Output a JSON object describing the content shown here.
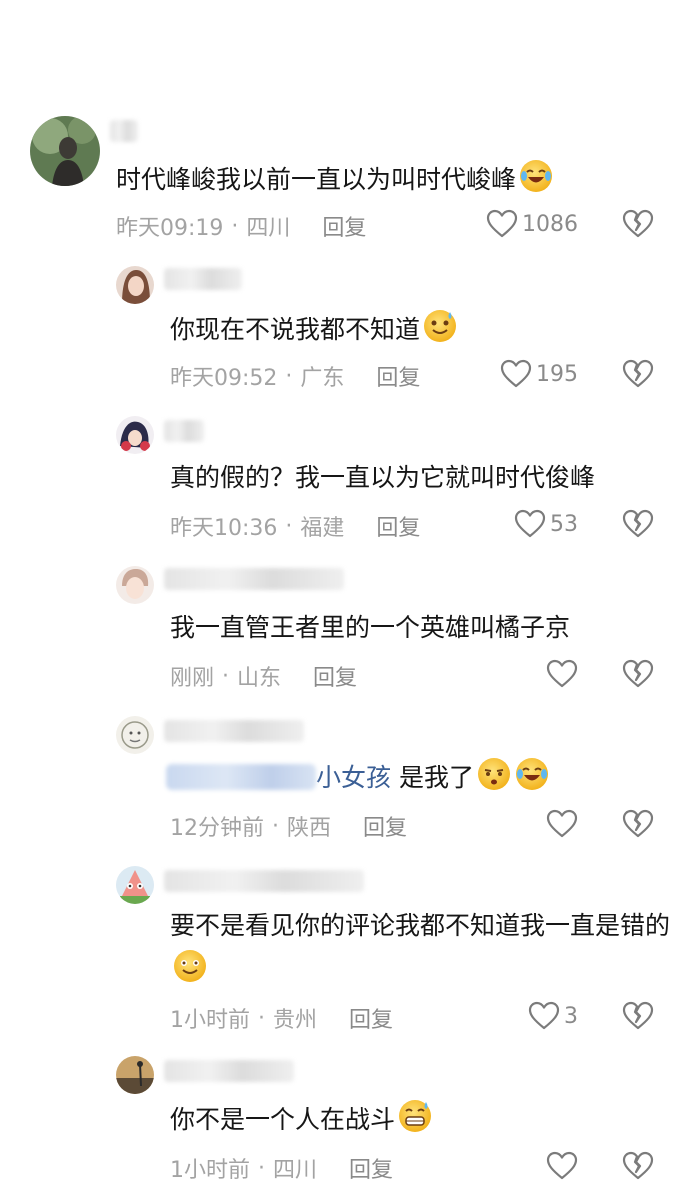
{
  "comments": [
    {
      "text": "时代峰峻我以前一直以为叫时代峻峰",
      "emoji": "laughing-crying-emoji",
      "time": "昨天09:19",
      "location": "四川",
      "reply": "回复",
      "likes": "1086"
    },
    {
      "text": "你现在不说我都不知道",
      "emoji": "sweat-smile-emoji",
      "time": "昨天09:52",
      "location": "广东",
      "reply": "回复",
      "likes": "195"
    },
    {
      "text": "真的假的？我一直以为它就叫时代俊峰",
      "time": "昨天10:36",
      "location": "福建",
      "reply": "回复",
      "likes": "53"
    },
    {
      "text": "我一直管王者里的一个英雄叫橘子京",
      "time": "刚刚",
      "location": "山东",
      "reply": "回复",
      "likes": ""
    },
    {
      "link_text": "小女孩",
      "text": " 是我了",
      "emoji": "smirk-emoji",
      "emoji2": "laughing-crying-emoji",
      "time": "12分钟前",
      "location": "陕西",
      "reply": "回复",
      "likes": ""
    },
    {
      "text": "要不是看见你的评论我都不知道我一直是错的",
      "emoji": "smile-emoji",
      "time": "1小时前",
      "location": "贵州",
      "reply": "回复",
      "likes": "3"
    },
    {
      "text": "你不是一个人在战斗",
      "emoji": "grimace-sweat-emoji",
      "time": "1小时前",
      "location": "四川",
      "reply": "回复",
      "likes": ""
    }
  ],
  "separator": "·",
  "colors": {
    "text": "#161616",
    "meta": "#a3a3a3",
    "link": "#3b5f95",
    "emoji_face": "#f7c631"
  }
}
